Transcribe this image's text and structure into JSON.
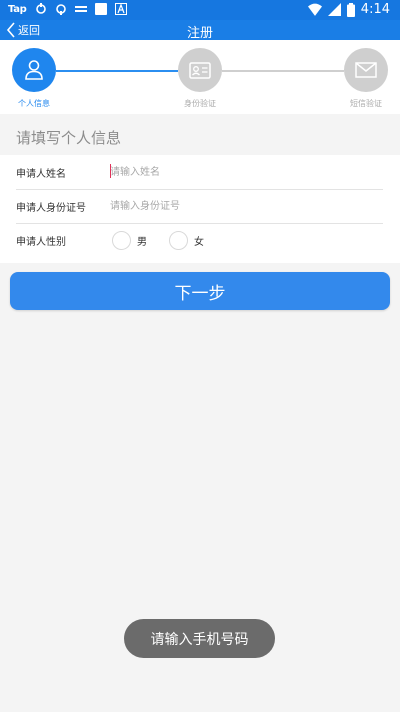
{
  "status_bar": {
    "app_label": "Tap",
    "time": "4:14",
    "icons": [
      "sync-icon",
      "sync-icon",
      "keyboard-icon",
      "square-icon",
      "font-icon",
      "wifi-icon",
      "signal-icon",
      "battery-icon"
    ],
    "color": "#1677e0"
  },
  "nav": {
    "back_label": "返回",
    "title": "注册"
  },
  "steps": [
    {
      "label": "个人信息",
      "icon": "person-icon",
      "state": "active"
    },
    {
      "label": "身份验证",
      "icon": "id-card-icon",
      "state": "inactive"
    },
    {
      "label": "短信验证",
      "icon": "envelope-icon",
      "state": "inactive"
    }
  ],
  "section_title": "请填写个人信息",
  "form": {
    "name_label": "申请人姓名",
    "name_placeholder": "请输入姓名",
    "id_label": "申请人身份证号",
    "id_placeholder": "请输入身份证号",
    "gender_label": "申请人性别",
    "gender_options": [
      "男",
      "女"
    ]
  },
  "next_button": "下一步",
  "toast": "请输入手机号码",
  "colors": {
    "primary": "#1f86ee",
    "inactive": "#cfcfcf",
    "background": "#f4f4f4"
  }
}
